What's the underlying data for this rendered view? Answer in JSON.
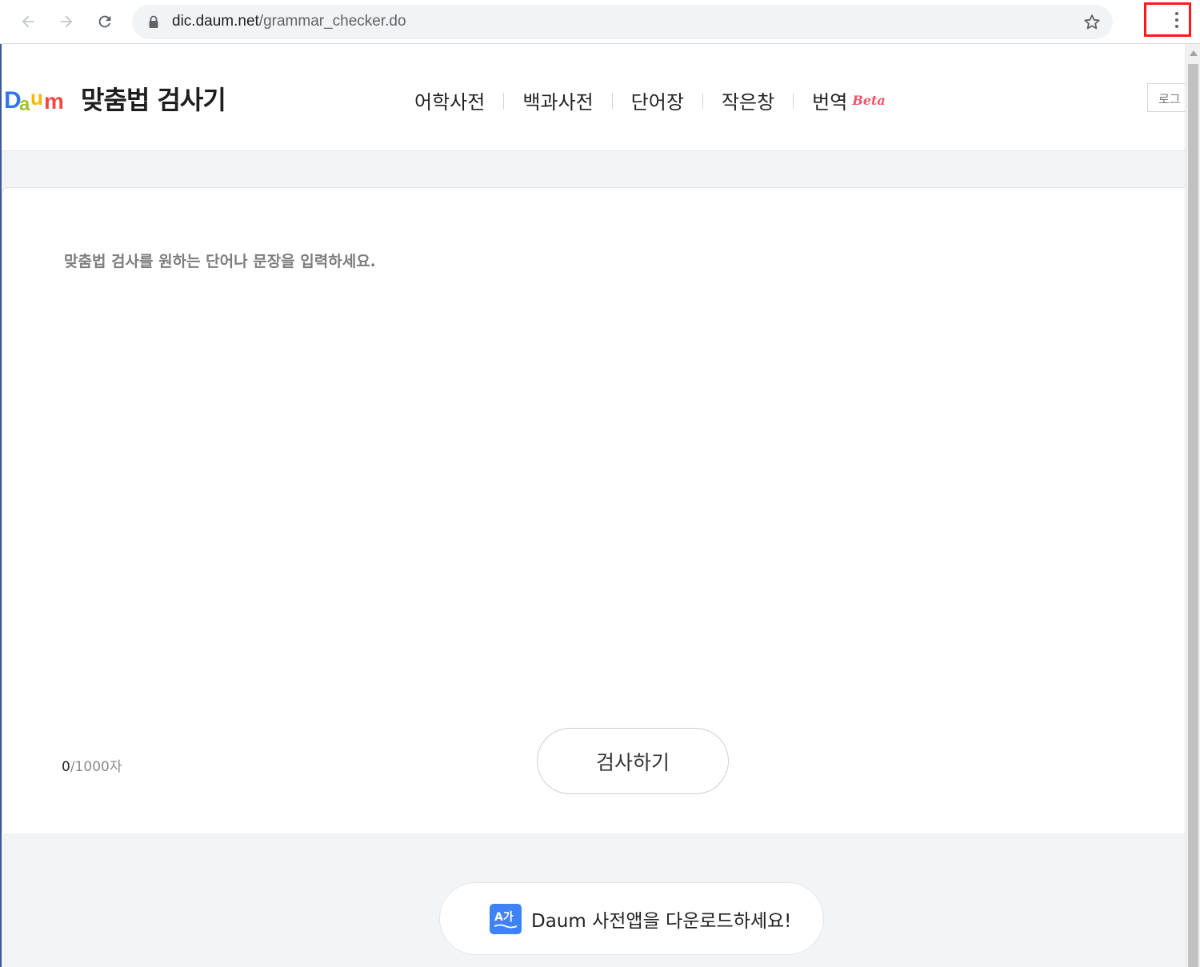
{
  "browser": {
    "url_host": "dic.daum.net",
    "url_path": "/grammar_checker.do",
    "icons": [
      "back-arrow-icon",
      "forward-arrow-icon",
      "reload-icon",
      "lock-icon",
      "star-icon",
      "kebab-menu-icon"
    ]
  },
  "header": {
    "logo_alt": "Daum",
    "title": "맞춤법 검사기",
    "nav": [
      {
        "label": "어학사전"
      },
      {
        "label": "백과사전"
      },
      {
        "label": "단어장"
      },
      {
        "label": "작은창"
      },
      {
        "label": "번역",
        "badge": "Beta"
      }
    ],
    "login_label": "로그"
  },
  "editor": {
    "placeholder": "맞춤법 검사를 원하는 단어나 문장을 입력하세요.",
    "count_current": "0",
    "count_max": "/1000자",
    "check_button": "검사하기"
  },
  "banner": {
    "icon_text": "A가",
    "text": "Daum 사전앱을 다운로드하세요!"
  },
  "colors": {
    "beta": "#f2536b",
    "app_icon": "#3f82f6",
    "highlight_box": "#ff1a1a"
  }
}
